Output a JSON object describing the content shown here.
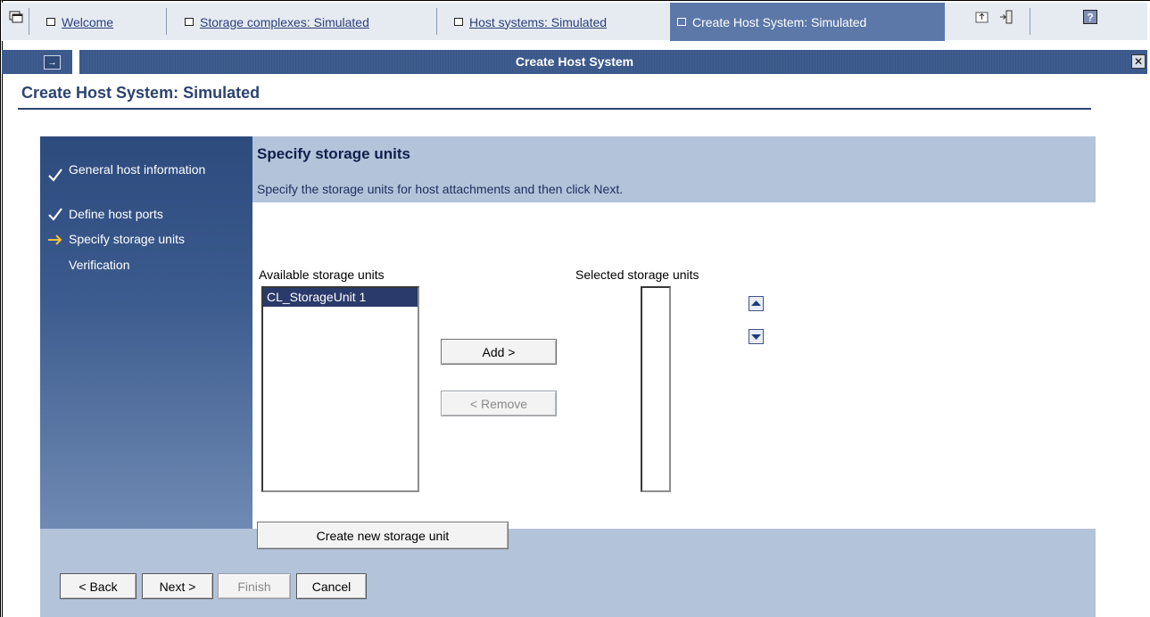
{
  "tabs": [
    {
      "label": "Welcome",
      "active": false
    },
    {
      "label": "Storage complexes: Simulated",
      "active": false
    },
    {
      "label": "Host systems: Simulated",
      "active": false
    },
    {
      "label": "Create Host System: Simulated",
      "active": true
    }
  ],
  "portlet": {
    "title": "Create Host System"
  },
  "page": {
    "title": "Create Host System: Simulated"
  },
  "wizard": {
    "steps": [
      {
        "label": "General host information",
        "state": "done"
      },
      {
        "label": "Define host ports",
        "state": "done"
      },
      {
        "label": "Specify storage units",
        "state": "current"
      },
      {
        "label": "Verification",
        "state": "pending"
      }
    ],
    "heading": "Specify storage units",
    "description": "Specify the storage units for host attachments and then click Next.",
    "available_label": "Available storage units",
    "selected_label": "Selected storage units",
    "available_items": [
      "CL_StorageUnit 1"
    ],
    "selected_items": [],
    "add_label": "Add >",
    "remove_label": "< Remove",
    "create_label": "Create new storage unit"
  },
  "footer": {
    "back": "< Back",
    "next": "Next >",
    "finish": "Finish",
    "cancel": "Cancel"
  },
  "colors": {
    "accent": "#2c4470",
    "nav": "#2d4b7d",
    "panel": "#b3c3da",
    "current_arrow": "#f2c237"
  },
  "icons": [
    "windows-icon",
    "tab-box-icon",
    "export-icon",
    "logout-icon",
    "help-icon",
    "collapse-icon",
    "close-icon",
    "check-icon",
    "arrow-right-icon",
    "move-up-icon",
    "move-down-icon"
  ]
}
